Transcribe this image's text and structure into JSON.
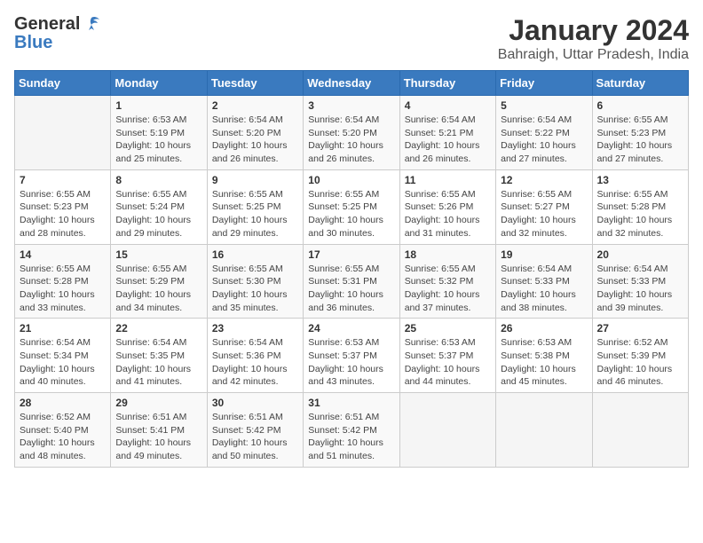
{
  "header": {
    "logo_general": "General",
    "logo_blue": "Blue",
    "month_year": "January 2024",
    "location": "Bahraigh, Uttar Pradesh, India"
  },
  "weekdays": [
    "Sunday",
    "Monday",
    "Tuesday",
    "Wednesday",
    "Thursday",
    "Friday",
    "Saturday"
  ],
  "weeks": [
    [
      {
        "day": "",
        "info": ""
      },
      {
        "day": "1",
        "info": "Sunrise: 6:53 AM\nSunset: 5:19 PM\nDaylight: 10 hours\nand 25 minutes."
      },
      {
        "day": "2",
        "info": "Sunrise: 6:54 AM\nSunset: 5:20 PM\nDaylight: 10 hours\nand 26 minutes."
      },
      {
        "day": "3",
        "info": "Sunrise: 6:54 AM\nSunset: 5:20 PM\nDaylight: 10 hours\nand 26 minutes."
      },
      {
        "day": "4",
        "info": "Sunrise: 6:54 AM\nSunset: 5:21 PM\nDaylight: 10 hours\nand 26 minutes."
      },
      {
        "day": "5",
        "info": "Sunrise: 6:54 AM\nSunset: 5:22 PM\nDaylight: 10 hours\nand 27 minutes."
      },
      {
        "day": "6",
        "info": "Sunrise: 6:55 AM\nSunset: 5:23 PM\nDaylight: 10 hours\nand 27 minutes."
      }
    ],
    [
      {
        "day": "7",
        "info": "Sunrise: 6:55 AM\nSunset: 5:23 PM\nDaylight: 10 hours\nand 28 minutes."
      },
      {
        "day": "8",
        "info": "Sunrise: 6:55 AM\nSunset: 5:24 PM\nDaylight: 10 hours\nand 29 minutes."
      },
      {
        "day": "9",
        "info": "Sunrise: 6:55 AM\nSunset: 5:25 PM\nDaylight: 10 hours\nand 29 minutes."
      },
      {
        "day": "10",
        "info": "Sunrise: 6:55 AM\nSunset: 5:25 PM\nDaylight: 10 hours\nand 30 minutes."
      },
      {
        "day": "11",
        "info": "Sunrise: 6:55 AM\nSunset: 5:26 PM\nDaylight: 10 hours\nand 31 minutes."
      },
      {
        "day": "12",
        "info": "Sunrise: 6:55 AM\nSunset: 5:27 PM\nDaylight: 10 hours\nand 32 minutes."
      },
      {
        "day": "13",
        "info": "Sunrise: 6:55 AM\nSunset: 5:28 PM\nDaylight: 10 hours\nand 32 minutes."
      }
    ],
    [
      {
        "day": "14",
        "info": "Sunrise: 6:55 AM\nSunset: 5:28 PM\nDaylight: 10 hours\nand 33 minutes."
      },
      {
        "day": "15",
        "info": "Sunrise: 6:55 AM\nSunset: 5:29 PM\nDaylight: 10 hours\nand 34 minutes."
      },
      {
        "day": "16",
        "info": "Sunrise: 6:55 AM\nSunset: 5:30 PM\nDaylight: 10 hours\nand 35 minutes."
      },
      {
        "day": "17",
        "info": "Sunrise: 6:55 AM\nSunset: 5:31 PM\nDaylight: 10 hours\nand 36 minutes."
      },
      {
        "day": "18",
        "info": "Sunrise: 6:55 AM\nSunset: 5:32 PM\nDaylight: 10 hours\nand 37 minutes."
      },
      {
        "day": "19",
        "info": "Sunrise: 6:54 AM\nSunset: 5:33 PM\nDaylight: 10 hours\nand 38 minutes."
      },
      {
        "day": "20",
        "info": "Sunrise: 6:54 AM\nSunset: 5:33 PM\nDaylight: 10 hours\nand 39 minutes."
      }
    ],
    [
      {
        "day": "21",
        "info": "Sunrise: 6:54 AM\nSunset: 5:34 PM\nDaylight: 10 hours\nand 40 minutes."
      },
      {
        "day": "22",
        "info": "Sunrise: 6:54 AM\nSunset: 5:35 PM\nDaylight: 10 hours\nand 41 minutes."
      },
      {
        "day": "23",
        "info": "Sunrise: 6:54 AM\nSunset: 5:36 PM\nDaylight: 10 hours\nand 42 minutes."
      },
      {
        "day": "24",
        "info": "Sunrise: 6:53 AM\nSunset: 5:37 PM\nDaylight: 10 hours\nand 43 minutes."
      },
      {
        "day": "25",
        "info": "Sunrise: 6:53 AM\nSunset: 5:37 PM\nDaylight: 10 hours\nand 44 minutes."
      },
      {
        "day": "26",
        "info": "Sunrise: 6:53 AM\nSunset: 5:38 PM\nDaylight: 10 hours\nand 45 minutes."
      },
      {
        "day": "27",
        "info": "Sunrise: 6:52 AM\nSunset: 5:39 PM\nDaylight: 10 hours\nand 46 minutes."
      }
    ],
    [
      {
        "day": "28",
        "info": "Sunrise: 6:52 AM\nSunset: 5:40 PM\nDaylight: 10 hours\nand 48 minutes."
      },
      {
        "day": "29",
        "info": "Sunrise: 6:51 AM\nSunset: 5:41 PM\nDaylight: 10 hours\nand 49 minutes."
      },
      {
        "day": "30",
        "info": "Sunrise: 6:51 AM\nSunset: 5:42 PM\nDaylight: 10 hours\nand 50 minutes."
      },
      {
        "day": "31",
        "info": "Sunrise: 6:51 AM\nSunset: 5:42 PM\nDaylight: 10 hours\nand 51 minutes."
      },
      {
        "day": "",
        "info": ""
      },
      {
        "day": "",
        "info": ""
      },
      {
        "day": "",
        "info": ""
      }
    ]
  ]
}
